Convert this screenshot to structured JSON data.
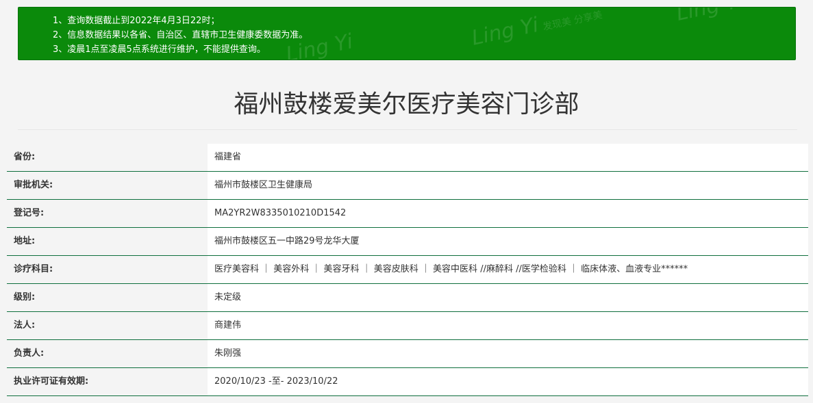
{
  "notice": {
    "lines": [
      "1、查询数据截止到2022年4月3日22时；",
      "2、信息数据结果以各省、自治区、直辖市卫生健康委数据为准。",
      "3、凌晨1点至凌晨5点系统进行维护，不能提供查询。"
    ],
    "watermark": {
      "brand": "Ling Yi",
      "slogan": "发现美 分享美"
    }
  },
  "title": "福州鼓楼爱美尔医疗美容门诊部",
  "fields": [
    {
      "label": "省份:",
      "value": "福建省"
    },
    {
      "label": "审批机关:",
      "value": "福州市鼓楼区卫生健康局"
    },
    {
      "label": "登记号:",
      "value": "MA2YR2W8335010210D1542"
    },
    {
      "label": "地址:",
      "value": "福州市鼓楼区五一中路29号龙华大厦"
    },
    {
      "label": "诊疗科目:",
      "value": "医疗美容科 ｜ 美容外科 ｜ 美容牙科 ｜ 美容皮肤科 ｜ 美容中医科 //麻醉科 //医学检验科 ｜ 临床体液、血液专业******"
    },
    {
      "label": "级别:",
      "value": "未定级"
    },
    {
      "label": "法人:",
      "value": "商建伟"
    },
    {
      "label": "负责人:",
      "value": "朱刚强"
    },
    {
      "label": "执业许可证有效期:",
      "value": "2020/10/23 -至- 2023/10/22"
    }
  ],
  "colors": {
    "notice_bg": "#0b8a0b",
    "row_border": "#0d6e3c"
  }
}
